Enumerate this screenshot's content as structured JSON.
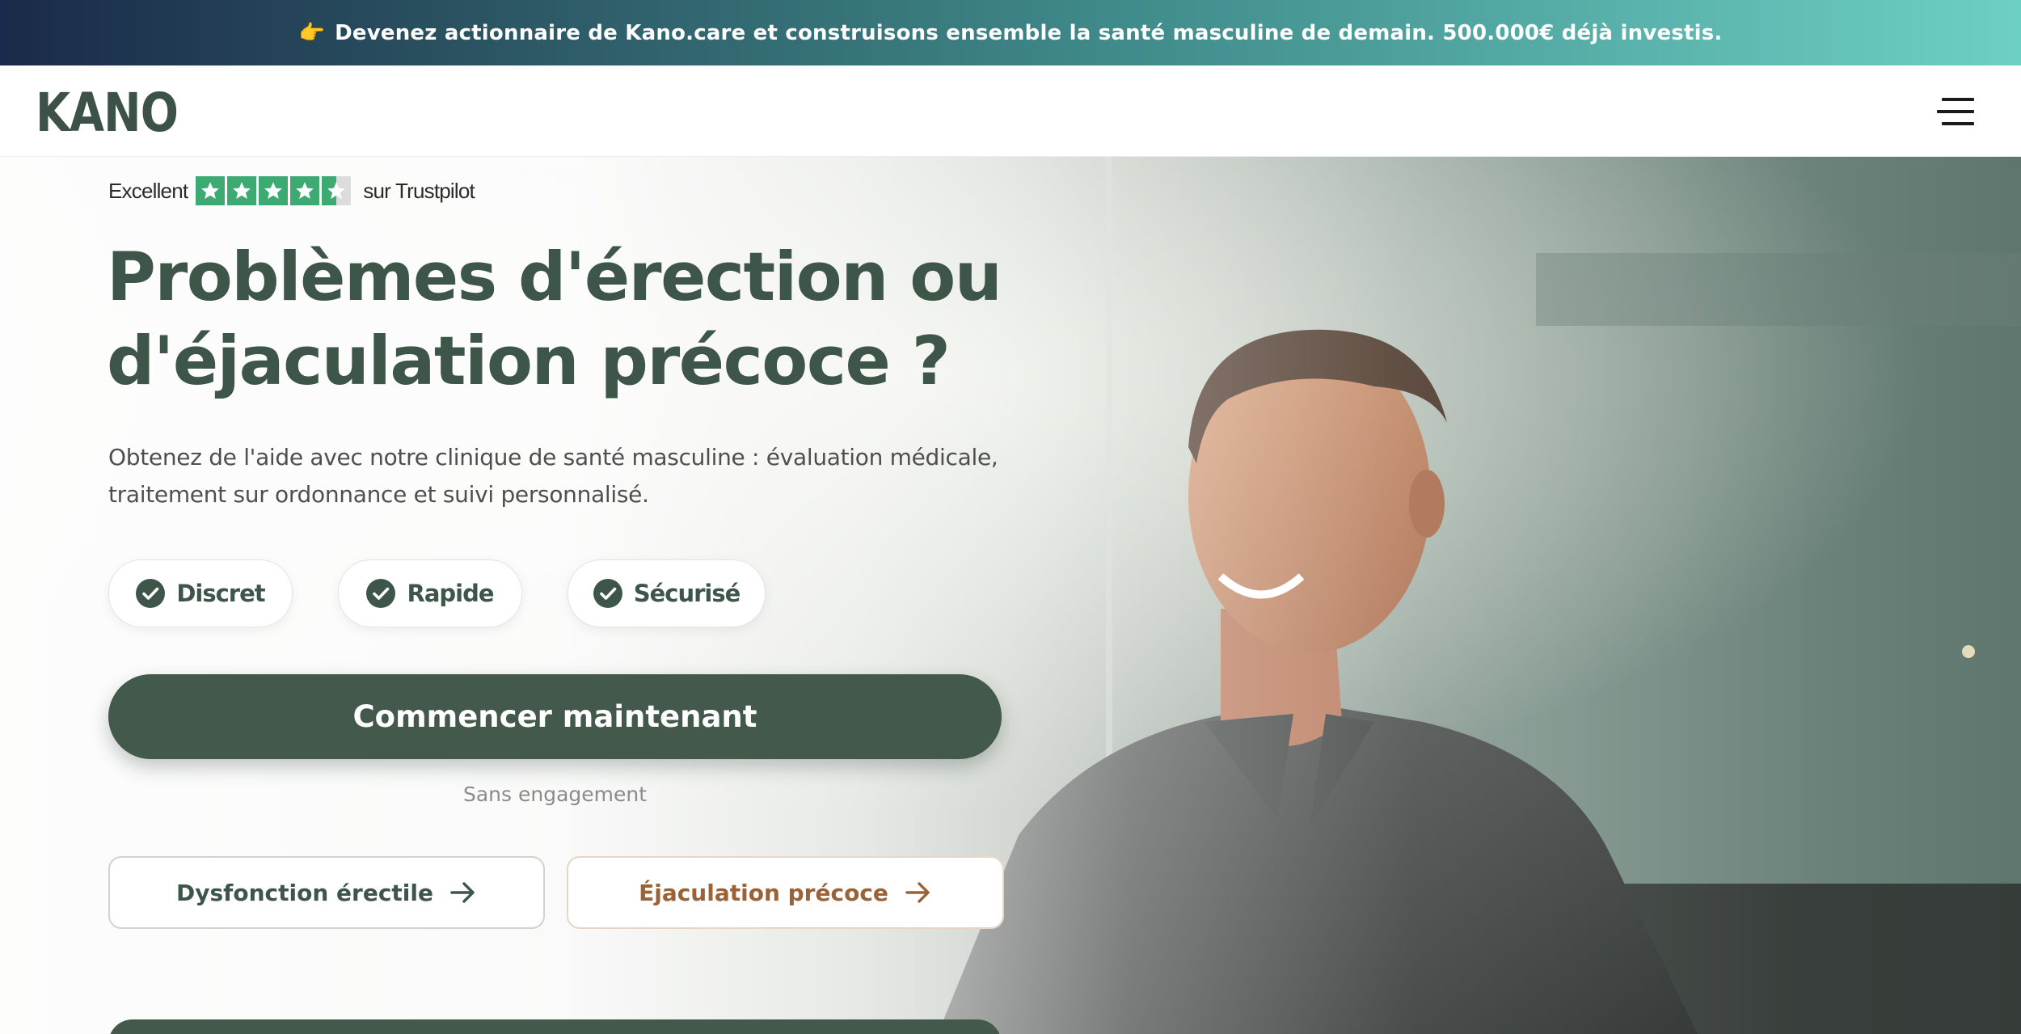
{
  "announcement": {
    "icon": "pointing-hand-icon",
    "text": "Devenez actionnaire de Kano.care et construisons ensemble la santé masculine de demain. 500.000€ déjà investis."
  },
  "header": {
    "logo": "KANO",
    "menu_icon": "hamburger-menu-icon"
  },
  "hero": {
    "trustpilot": {
      "rating_word": "Excellent",
      "stars": 4.5,
      "suffix": "sur Trustpilot"
    },
    "headline_line1": "Problèmes d'érection ou",
    "headline_line2": "d'éjaculation précoce ?",
    "subtitle_line1": "Obtenez de l'aide avec notre clinique de santé masculine : évaluation médicale,",
    "subtitle_line2": "traitement sur ordonnance et suivi personnalisé.",
    "badges": [
      {
        "label": "Discret",
        "icon": "check-circle-icon"
      },
      {
        "label": "Rapide",
        "icon": "check-circle-icon"
      },
      {
        "label": "Sécurisé",
        "icon": "check-circle-icon"
      }
    ],
    "cta_label": "Commencer maintenant",
    "cta_note": "Sans engagement",
    "links": [
      {
        "label": "Dysfonction érectile",
        "icon": "arrow-right-icon"
      },
      {
        "label": "Éjaculation précoce",
        "icon": "arrow-right-icon"
      }
    ]
  },
  "colors": {
    "brand_green": "#42594c",
    "headline_green": "#3e5649",
    "trustpilot_green": "#3daa72",
    "accent_brown": "#9a6236"
  }
}
